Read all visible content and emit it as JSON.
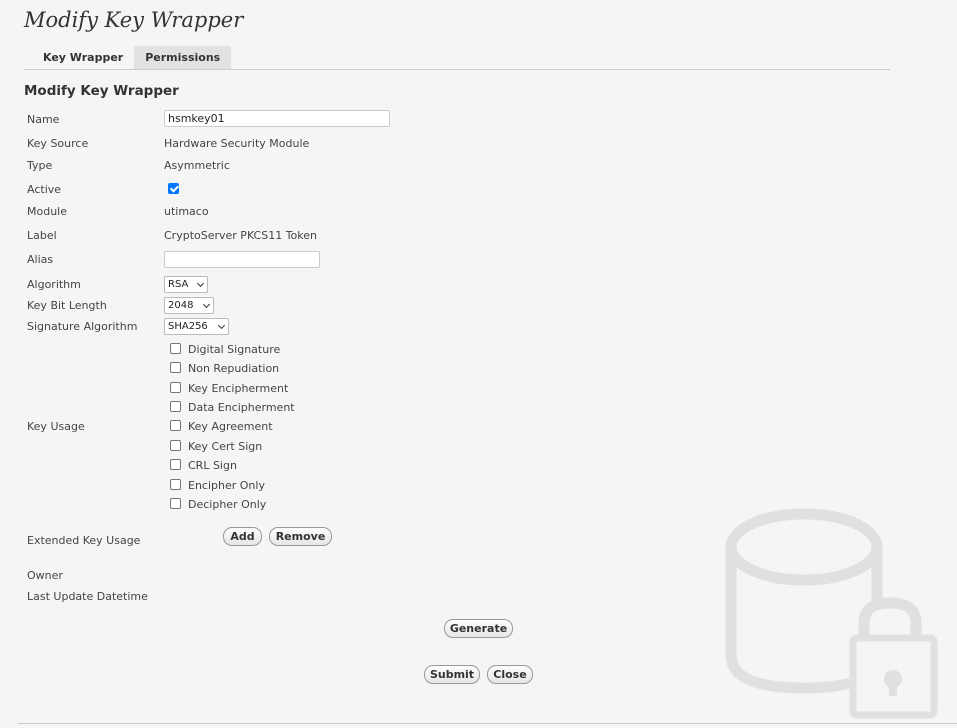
{
  "page": {
    "title": "Modify Key Wrapper"
  },
  "tabs": [
    {
      "label": "Key Wrapper",
      "active": true
    },
    {
      "label": "Permissions",
      "active": false
    }
  ],
  "form": {
    "title": "Modify Key Wrapper",
    "fields": {
      "name": {
        "label": "Name",
        "value": "hsmkey01"
      },
      "key_source": {
        "label": "Key Source",
        "value": "Hardware Security Module"
      },
      "type": {
        "label": "Type",
        "value": "Asymmetric"
      },
      "active": {
        "label": "Active",
        "checked": true
      },
      "module": {
        "label": "Module",
        "value": "utimaco"
      },
      "label": {
        "label": "Label",
        "value": "CryptoServer PKCS11 Token"
      },
      "alias": {
        "label": "Alias",
        "value": ""
      },
      "algorithm": {
        "label": "Algorithm",
        "value": "RSA"
      },
      "key_bit_length": {
        "label": "Key Bit Length",
        "value": "2048"
      },
      "signature_algorithm": {
        "label": "Signature Algorithm",
        "value": "SHA256"
      },
      "key_usage": {
        "label": "Key Usage",
        "options": [
          {
            "label": "Digital Signature",
            "checked": false
          },
          {
            "label": "Non Repudiation",
            "checked": false
          },
          {
            "label": "Key Encipherment",
            "checked": false
          },
          {
            "label": "Data Encipherment",
            "checked": false
          },
          {
            "label": "Key Agreement",
            "checked": false
          },
          {
            "label": "Key Cert Sign",
            "checked": false
          },
          {
            "label": "CRL Sign",
            "checked": false
          },
          {
            "label": "Encipher Only",
            "checked": false
          },
          {
            "label": "Decipher Only",
            "checked": false
          }
        ]
      },
      "extended_key_usage": {
        "label": "Extended Key Usage",
        "add_label": "Add",
        "remove_label": "Remove"
      },
      "owner": {
        "label": "Owner",
        "value": ""
      },
      "last_update": {
        "label": "Last Update Datetime",
        "value": ""
      }
    },
    "generate_label": "Generate",
    "submit_label": "Submit",
    "close_label": "Close"
  },
  "icons": {
    "watermark": "database-lock-icon"
  },
  "colors": {
    "checkbox_accent": "#0075ff",
    "watermark": "#e0e0e0"
  }
}
